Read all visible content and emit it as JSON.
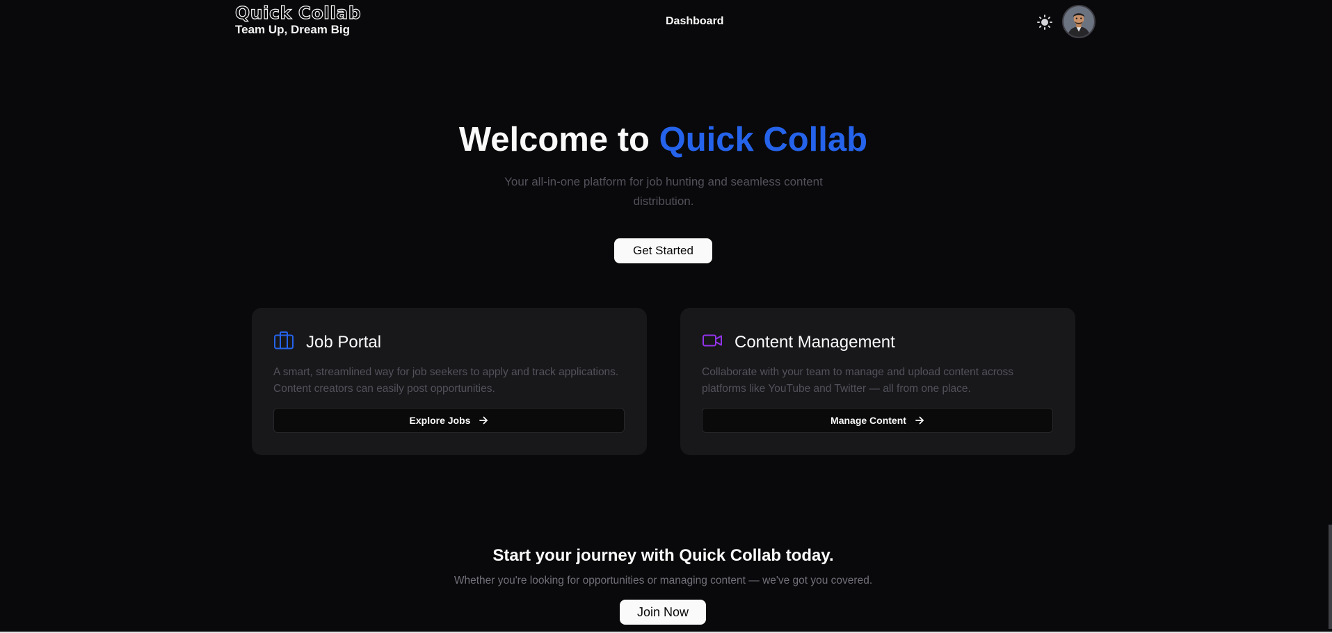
{
  "brand": {
    "title": "Quick Collab",
    "tagline": "Team Up, Dream Big"
  },
  "nav": {
    "dashboard": "Dashboard",
    "theme_icon": "sun-icon",
    "avatar_icon": "user-avatar"
  },
  "hero": {
    "title_prefix": "Welcome to",
    "title_accent": "Quick Collab",
    "subtitle": "Your all-in-one platform for job hunting and seamless content distribution.",
    "cta": "Get Started"
  },
  "cards": [
    {
      "icon": "briefcase-icon",
      "icon_color": "#2563eb",
      "title": "Job Portal",
      "description": "A smart, streamlined way for job seekers to apply and track applications. Content creators can easily post opportunities.",
      "button": "Explore Jobs"
    },
    {
      "icon": "video-icon",
      "icon_color": "#9333ea",
      "title": "Content Management",
      "description": "Collaborate with your team to manage and upload content across platforms like YouTube and Twitter — all from one place.",
      "button": "Manage Content"
    }
  ],
  "cta_section": {
    "title": "Start your journey with Quick Collab today.",
    "subtitle": "Whether you're looking for opportunities or managing content — we've got you covered.",
    "button": "Join Now"
  },
  "colors": {
    "background": "#09090b",
    "accent": "#2563eb",
    "card": "#18181b",
    "muted_text": "#52525b"
  }
}
